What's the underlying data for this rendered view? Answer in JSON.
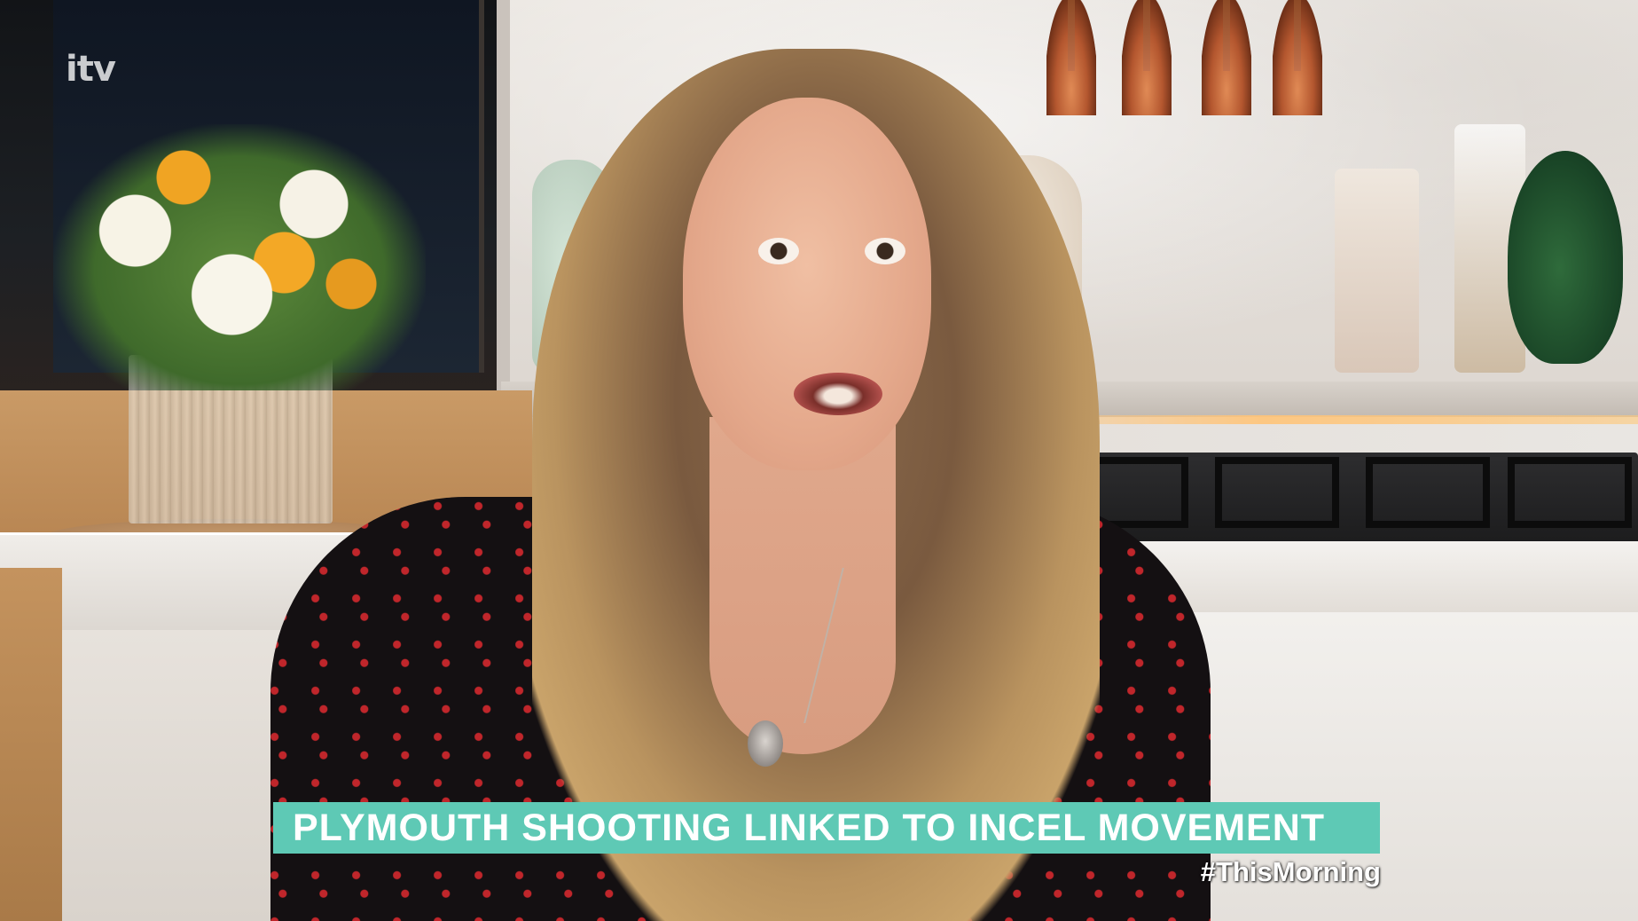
{
  "broadcast": {
    "channel_logo": "itv",
    "caption": "PLYMOUTH SHOOTING LINKED TO INCEL MOVEMENT",
    "hashtag": "#ThisMorning",
    "caption_bar_color": "#5ec9b5",
    "caption_text_color": "#ffffff"
  }
}
